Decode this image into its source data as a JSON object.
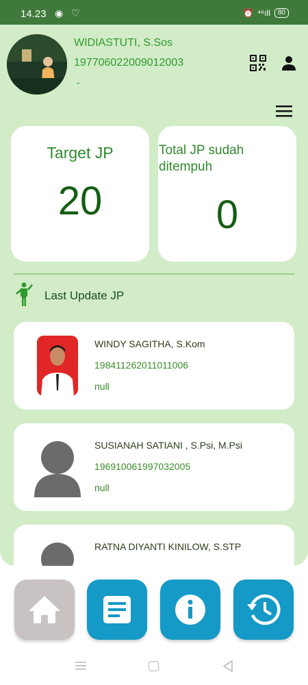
{
  "status_bar": {
    "time": "14.23",
    "left_icons": "◉ ♡",
    "network": "⁴⁶ıll",
    "battery": "80"
  },
  "profile": {
    "name": "WIDIASTUTI, S.Sos",
    "nip": "197706022009012003",
    "extra": "-"
  },
  "stats": {
    "target_label": "Target JP",
    "target_value": "20",
    "total_label": "Total JP sudah ditempuh",
    "total_value": "0"
  },
  "section": {
    "title": "Last Update JP"
  },
  "list": [
    {
      "name": "WINDY SAGITHA, S.Kom",
      "nip": "198411262011011006",
      "info": "null"
    },
    {
      "name": "SUSIANAH SATIANI , S.Psi, M.Psi",
      "nip": "196910061997032005",
      "info": "null"
    },
    {
      "name": "RATNA DIYANTI KINILOW, S.STP",
      "nip": "",
      "info": ""
    }
  ],
  "colors": {
    "accent_green": "#2f9a2f",
    "bg_green": "#d2ecc8",
    "button_blue": "#1599c6",
    "button_grey": "#c9c2c2",
    "status_bar": "#3f7a3b"
  },
  "icons": [
    "qr-code-icon",
    "user-icon",
    "menu-icon",
    "walking-person-icon",
    "home-icon",
    "document-icon",
    "info-icon",
    "history-icon"
  ]
}
